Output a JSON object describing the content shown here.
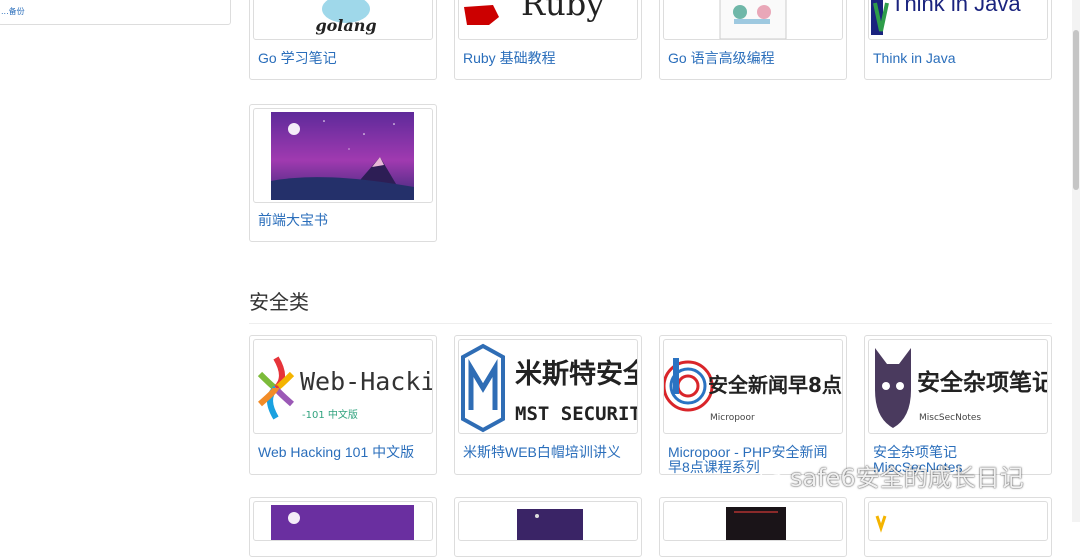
{
  "sidebar": {
    "item_text": "...备份"
  },
  "row1": [
    {
      "logo": "golang",
      "title": "Go 学习笔记"
    },
    {
      "logo": "Ruby",
      "title": "Ruby 基础教程"
    },
    {
      "title": "Go 语言高级编程"
    },
    {
      "logo": "Think in Java",
      "title": "Think in Java"
    }
  ],
  "row2": [
    {
      "title": "前端大宝书"
    }
  ],
  "section": {
    "title": "安全类"
  },
  "security": [
    {
      "logo_main": "Web-Hacking",
      "logo_sub": "-101 中文版",
      "title": "Web Hacking 101 中文版"
    },
    {
      "logo_main": "米斯特安全",
      "logo_sub": "MST SECURITY",
      "title": "米斯特WEB白帽培训讲义"
    },
    {
      "logo_main": "安全新闻早8点",
      "logo_sub": "Micropoor",
      "title_line1": "Micropoor - PHP安全新闻",
      "title_line2": "早8点课程系列"
    },
    {
      "logo_main": "安全杂项笔记",
      "logo_sub": "MiscSecNotes",
      "title_line1": "安全杂项笔记",
      "title_line2": "MiscSecNotes"
    }
  ],
  "watermark": {
    "text": "safe6安全的成长日记",
    "icon": "wechat-icon"
  },
  "colors": {
    "link": "#2a6ebb",
    "border": "#dddddd",
    "ruby_red": "#cc0000",
    "mst_blue": "#2f6db5",
    "micropoor_red": "#d9252a",
    "misc_purple": "#4a3a5e"
  }
}
